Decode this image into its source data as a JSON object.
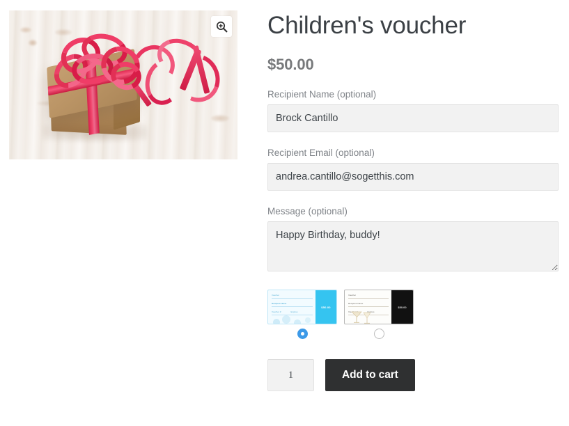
{
  "product": {
    "title": "Children's voucher",
    "price": "$50.00",
    "image_alt": "gift-box-with-red-ribbon-photo",
    "zoom_icon": "magnifier-plus-icon"
  },
  "fields": {
    "recipient_name": {
      "label": "Recipient Name (optional)",
      "value": "Brock Cantillo",
      "placeholder": ""
    },
    "recipient_email": {
      "label": "Recipient Email (optional)",
      "value": "andrea.cantillo@sogetthis.com",
      "placeholder": ""
    },
    "message": {
      "label": "Message (optional)",
      "value": "Happy Birthday, buddy!",
      "placeholder": ""
    }
  },
  "templates": [
    {
      "name": "blue-floral-voucher-template",
      "selected": true,
      "amount_label": "$50.00",
      "lines": [
        "Voucher",
        "Recipient Name",
        "Voucher #",
        "Expires"
      ]
    },
    {
      "name": "black-cocktail-voucher-template",
      "selected": false,
      "amount_label": "$50.00",
      "lines": [
        "Voucher",
        "Recipient Name",
        "Voucher #",
        "Expires"
      ]
    }
  ],
  "cart": {
    "quantity": "1",
    "add_to_cart_label": "Add to cart"
  },
  "colors": {
    "accent_blue": "#3d9ae8",
    "template_cyan": "#35c4f0",
    "button_dark": "#2f3031",
    "price_grey": "#77797b",
    "label_grey": "#7f8388",
    "input_bg": "#f2f2f2"
  }
}
